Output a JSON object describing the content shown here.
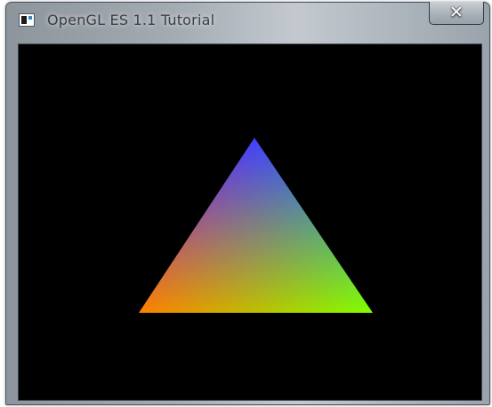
{
  "window": {
    "title": "OpenGL ES 1.1 Tutorial"
  },
  "icons": {
    "app": "app-window-icon",
    "close": "close-icon",
    "close_glyph": "✕"
  },
  "scene": {
    "background_color": "#000000",
    "shape": "triangle",
    "vertex_colors": {
      "top": "#0000ff",
      "bottom_left": "#ff0000",
      "bottom_right": "#00ff00"
    }
  }
}
